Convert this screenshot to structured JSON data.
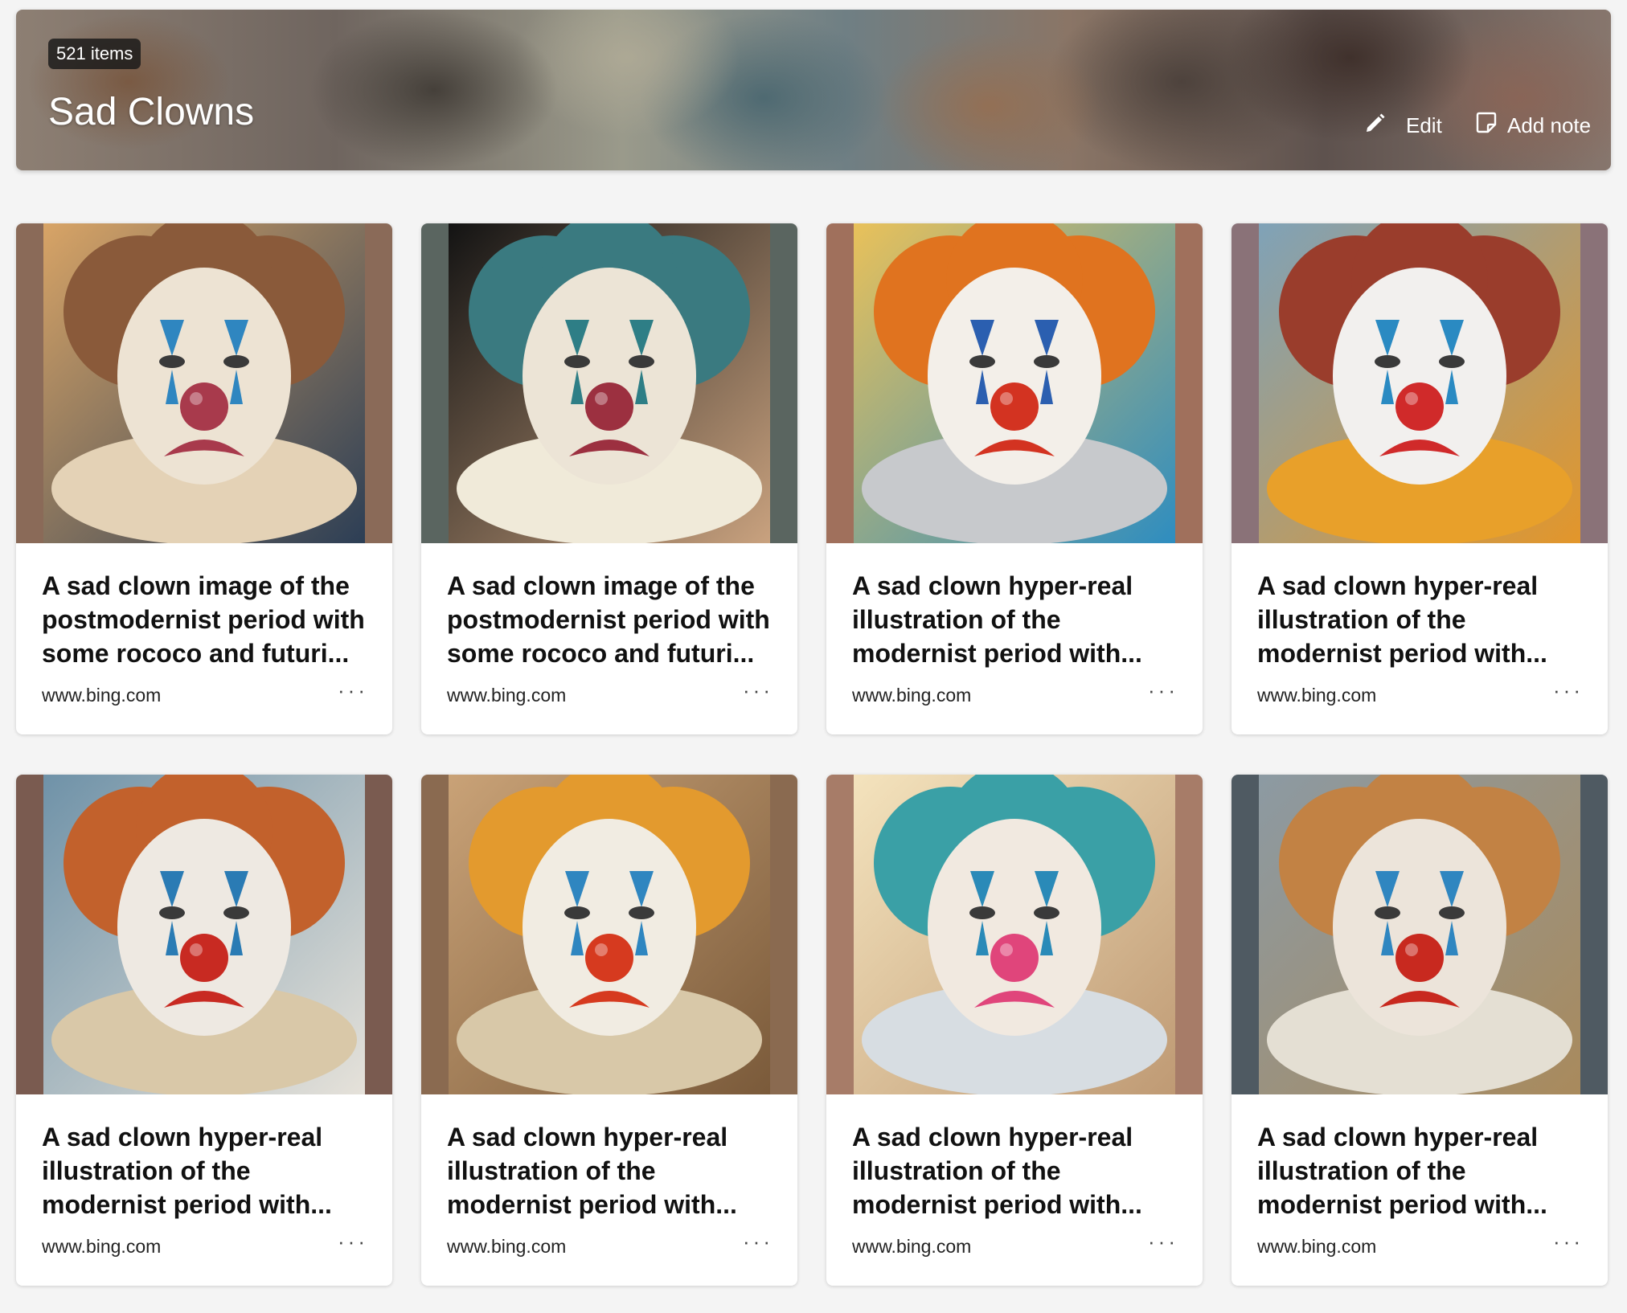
{
  "collection": {
    "count_label": "521 items",
    "title": "Sad Clowns",
    "edit_label": "Edit",
    "add_note_label": "Add note"
  },
  "colors": {
    "clown_white": "#f1ece2",
    "nose_red": "#c8291f",
    "diamond_blue": "#2f86c0"
  },
  "cards": [
    {
      "title": "A sad clown image of the postmodernist period with some rococo and futuri...",
      "source": "www.bing.com",
      "more": "···",
      "side": "#8a6a58",
      "bg": "#d8a466",
      "bg2": "#2c3e55",
      "hair": "#8a5a3a",
      "skin": "#ede3d3",
      "collar": "#e4d2b6",
      "nose": "#a83a4c",
      "diamond": "#2f86c0"
    },
    {
      "title": "A sad clown image of the postmodernist period with some rococo and futuri...",
      "source": "www.bing.com",
      "more": "···",
      "side": "#5a6560",
      "bg": "#131313",
      "bg2": "#c9a27f",
      "hair": "#3a7a80",
      "skin": "#ece4d6",
      "collar": "#f0ead9",
      "nose": "#9c3040",
      "diamond": "#2e7e86"
    },
    {
      "title": "A sad clown hyper-real illustration of the modernist period with...",
      "source": "www.bing.com",
      "more": "···",
      "side": "#a0705c",
      "bg": "#e9c15a",
      "bg2": "#2e8dc0",
      "hair": "#e0731f",
      "skin": "#f3efe9",
      "collar": "#c7c9cc",
      "nose": "#d33321",
      "diamond": "#2b5fb0"
    },
    {
      "title": "A sad clown hyper-real illustration of the modernist period with...",
      "source": "www.bing.com",
      "more": "···",
      "side": "#8a7278",
      "bg": "#7fa2b8",
      "bg2": "#e3962a",
      "hair": "#9a3d2c",
      "skin": "#f2f0ee",
      "collar": "#e8a02a",
      "nose": "#d02a2a",
      "diamond": "#2a8ac2"
    },
    {
      "title": "A sad clown hyper-real illustration of the modernist period with...",
      "source": "www.bing.com",
      "more": "···",
      "side": "#7a5b50",
      "bg": "#6f92a8",
      "bg2": "#e6e2da",
      "hair": "#c2612c",
      "skin": "#eee9e2",
      "collar": "#d9c8a8",
      "nose": "#c82a22",
      "diamond": "#2a7bb4"
    },
    {
      "title": "A sad clown hyper-real illustration of the modernist period with...",
      "source": "www.bing.com",
      "more": "···",
      "side": "#8a6a50",
      "bg": "#c9a277",
      "bg2": "#7a5a3a",
      "hair": "#e39a2e",
      "skin": "#f1ece2",
      "collar": "#d8c8a8",
      "nose": "#d63a1f",
      "diamond": "#2f86c0"
    },
    {
      "title": "A sad clown hyper-real illustration of the modernist period with...",
      "source": "www.bing.com",
      "more": "···",
      "side": "#a77c68",
      "bg": "#f4e3bd",
      "bg2": "#bf9a74",
      "hair": "#3aa0a6",
      "skin": "#f1e9e0",
      "collar": "#d7dde2",
      "nose": "#e0457b",
      "diamond": "#2a8ab8"
    },
    {
      "title": "A sad clown hyper-real illustration of the modernist period with...",
      "source": "www.bing.com",
      "more": "···",
      "side": "#4f5a62",
      "bg": "#8c9aa3",
      "bg2": "#a98a5c",
      "hair": "#c28244",
      "skin": "#ece4da",
      "collar": "#e4dfd3",
      "nose": "#c8291f",
      "diamond": "#2f86c0"
    }
  ]
}
